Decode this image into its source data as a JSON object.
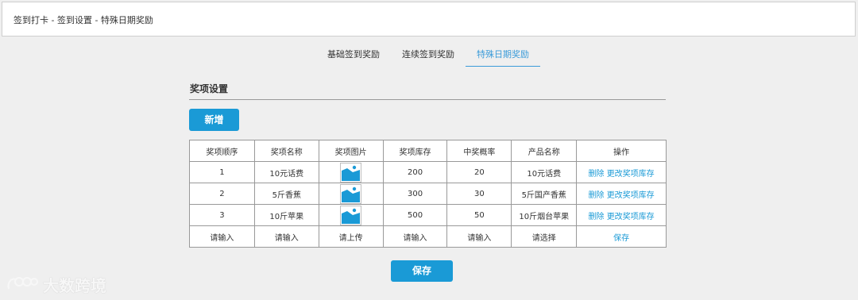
{
  "breadcrumb": "签到打卡 - 签到设置 - 特殊日期奖励",
  "tabs": [
    {
      "label": "基础签到奖励",
      "active": false
    },
    {
      "label": "连续签到奖励",
      "active": false
    },
    {
      "label": "特殊日期奖励",
      "active": true
    }
  ],
  "section_title": "奖项设置",
  "add_button": "新增",
  "table": {
    "headers": [
      "奖项顺序",
      "奖项名称",
      "奖项图片",
      "奖项库存",
      "中奖概率",
      "产品名称",
      "操作"
    ],
    "rows": [
      {
        "order": "1",
        "name": "10元话费",
        "stock": "200",
        "probability": "20",
        "product": "10元话费",
        "delete": "删除",
        "edit": "更改奖项库存"
      },
      {
        "order": "2",
        "name": "5斤香蕉",
        "stock": "300",
        "probability": "30",
        "product": "5斤国产香蕉",
        "delete": "删除",
        "edit": "更改奖项库存"
      },
      {
        "order": "3",
        "name": "10斤苹果",
        "stock": "500",
        "probability": "50",
        "product": "10斤烟台苹果",
        "delete": "删除",
        "edit": "更改奖项库存"
      }
    ],
    "input_row": {
      "order": "请输入",
      "name": "请输入",
      "image": "请上传",
      "stock": "请输入",
      "probability": "请输入",
      "product": "请选择",
      "save": "保存"
    }
  },
  "save_button": "保存",
  "watermark": "大数跨境",
  "colors": {
    "accent": "#1a9ad6",
    "background": "#efefef"
  }
}
